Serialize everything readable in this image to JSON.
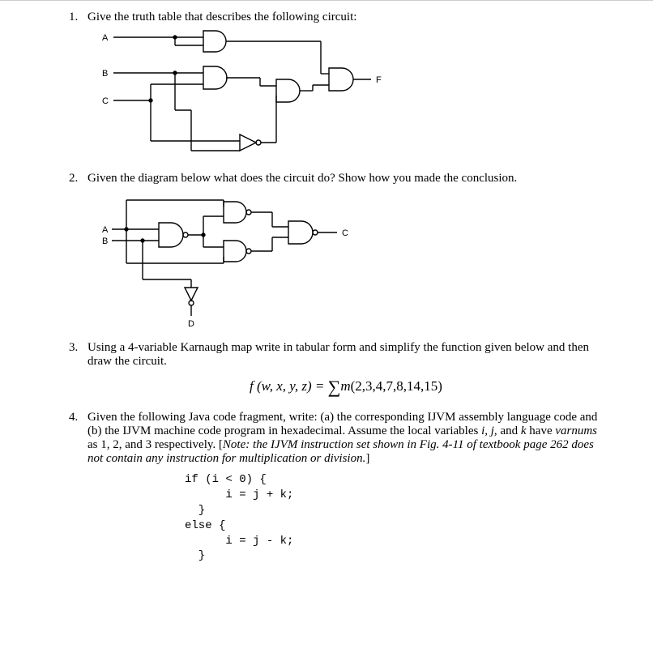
{
  "q1": {
    "prompt": "Give the truth table that describes the following circuit:",
    "labels": {
      "A": "A",
      "B": "B",
      "C": "C",
      "F": "F"
    }
  },
  "q2": {
    "prompt": "Given the diagram below what does the circuit do? Show how you made the conclusion.",
    "labels": {
      "A": "A",
      "B": "B",
      "C": "C",
      "D": "D"
    }
  },
  "q3": {
    "prompt": "Using a 4-variable Karnaugh map write in tabular form and simplify the function given below and then draw the circuit.",
    "equation_func": "f (w, x, y, z) = ",
    "equation_sum": "∑",
    "equation_m": "m",
    "equation_args": "(2,3,4,7,8,14,15)"
  },
  "q4": {
    "prompt_a": "Given the following Java code fragment, write: (a) the corresponding IJVM assembly language code and (b) the IJVM machine code program in hexadecimal.  Assume the local variables ",
    "vars_ij": "i, j,",
    "and": " and ",
    "var_k": "k",
    "have": " have ",
    "varnums": "varnums",
    "as123": " as 1, 2, and 3 respectively.  [",
    "note": "Note: the IJVM instruction set shown in Fig. 4-11 of textbook page 262 does not contain any instruction for multiplication or division.",
    "close": "]",
    "code": "if (i < 0) {\n      i = j + k;\n  }\nelse {\n      i = j - k;\n  }"
  }
}
